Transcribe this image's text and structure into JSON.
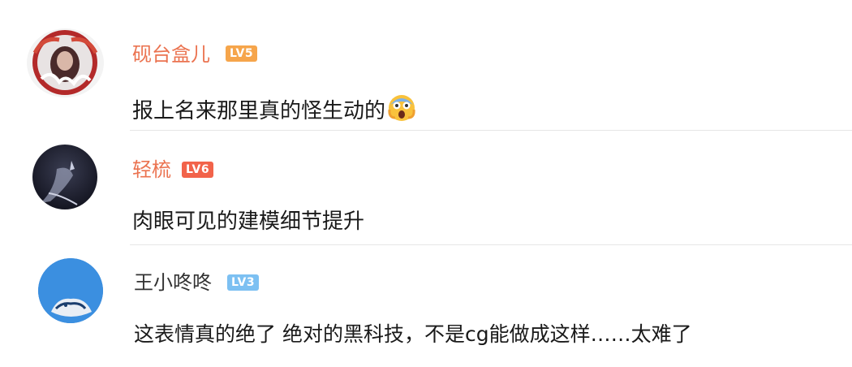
{
  "comments": [
    {
      "username": "砚台盒儿",
      "level": "LV5",
      "level_color": "#f6a54b",
      "name_color": "#eb7350",
      "text": "报上名来那里真的怪生动的",
      "emoji": "screaming-face-emoji"
    },
    {
      "username": "轻梳",
      "level": "LV6",
      "level_color": "#f2634a",
      "name_color": "#eb7350",
      "text": "肉眼可见的建模细节提升"
    },
    {
      "username": "王小咚咚",
      "level": "LV3",
      "level_color": "#7cc0f2",
      "name_color": "#333333",
      "text": "这表情真的绝了 绝对的黑科技，不是cg能做成这样……太难了"
    }
  ]
}
